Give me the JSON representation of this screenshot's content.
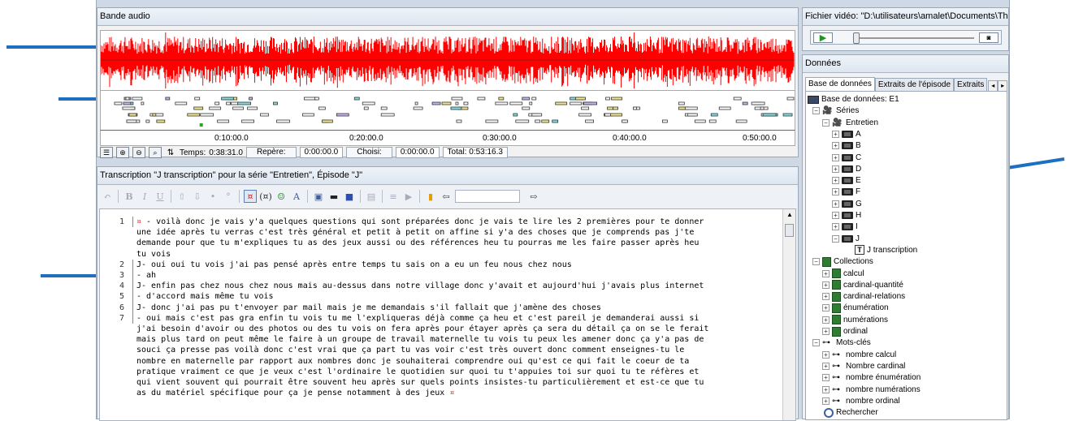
{
  "audio_panel": {
    "title": "Bande audio",
    "ticks": [
      "0:10:00.0",
      "0:20:00.0",
      "0:30:00.0",
      "0:40:00.0",
      "0:50:00.0"
    ],
    "temps_label": "Temps:",
    "temps_value": "0:38:31.0",
    "repere_label": "Repère:",
    "repere_value": "0:00:00.0",
    "choisi_label": "Choisi:",
    "choisi_value": "0:00:00.0",
    "total_text": "Total: 0:53:16.3"
  },
  "transcription_panel": {
    "title": "Transcription \"J transcription\" pour la série \"Entretien\", Épisode \"J\"",
    "lines": [
      {
        "num": "1",
        "rows": [
          "¤ - voilà donc je vais y'a quelques questions qui sont préparées donc je vais te lire les 2 premières pour te donner",
          "une idée après tu verras c'est très général et petit à petit on affine si y'a des choses que je comprends pas j'te",
          "demande pour que tu m'expliques tu as des jeux aussi ou des références heu tu pourras me les faire passer après  heu",
          "tu vois"
        ]
      },
      {
        "num": "2",
        "rows": [
          "J- oui oui tu vois j'ai pas pensé après entre temps tu sais on a eu un feu nous chez nous"
        ]
      },
      {
        "num": "3",
        "rows": [
          "- ah"
        ]
      },
      {
        "num": "4",
        "rows": [
          "J- enfin pas chez nous chez nous mais au-dessus dans notre village donc y'avait et aujourd'hui j'avais plus internet"
        ]
      },
      {
        "num": "5",
        "rows": [
          "- d'accord mais même tu vois"
        ]
      },
      {
        "num": "6",
        "rows": [
          "J- donc j'ai pas pu t'envoyer par mail mais je me demandais s'il fallait que j'amène des choses"
        ]
      },
      {
        "num": "7",
        "rows": [
          "- oui mais c'est pas gra enfin tu vois tu me l'expliqueras déjà comme ça heu et c'est pareil je demanderai aussi si",
          "j'ai besoin d'avoir ou des photos ou des tu vois on fera après pour étayer après ça sera du détail ça on se le ferait",
          "mais plus tard on peut même le faire à un groupe de travail maternelle tu vois tu peux les amener donc ça y'a pas de",
          "souci ça presse pas voilà donc c'est vrai que ça part tu vas voir c'est très ouvert donc comment enseignes-tu le",
          "nombre en maternelle par rapport aux nombres donc je souhaiterai comprendre  oui qu'est ce qui fait le coeur de ta",
          "pratique vraiment ce que je veux c'est l'ordinaire le quotidien sur quoi tu t'appuies toi sur quoi tu te réfères et",
          "qui vient souvent qui pourrait être souvent heu après sur quels points insistes-tu particulièrement et est-ce que tu",
          "as du matériel spécifique pour ça je pense notamment à des jeux ¤"
        ]
      }
    ]
  },
  "video_panel": {
    "title": "Fichier vidéo: \"D:\\utilisateurs\\amalet\\Documents\\Th..."
  },
  "donnees_panel": {
    "title": "Données",
    "tabs": [
      "Base de données",
      "Extraits de l'épisode",
      "Extraits"
    ],
    "tree": {
      "root": "Base de données: E1",
      "series": "Séries",
      "entretien": "Entretien",
      "episodes": [
        "A",
        "B",
        "C",
        "D",
        "E",
        "F",
        "G",
        "H",
        "I",
        "J"
      ],
      "transcription": "J transcription",
      "collections_label": "Collections",
      "collections": [
        "calcul",
        "cardinal-quantité",
        "cardinal-relations",
        "énumération",
        "numérations",
        "ordinal"
      ],
      "keywords_label": "Mots-clés",
      "keywords": [
        "nombre calcul",
        "Nombre cardinal",
        "nombre énumération",
        "nombre numérations",
        "nombre ordinal"
      ],
      "search": "Rechercher"
    }
  },
  "colors": {
    "waveform": "#ff0000",
    "arrow": "#1f6fc0",
    "panel_bg": "#cfd9e6"
  }
}
